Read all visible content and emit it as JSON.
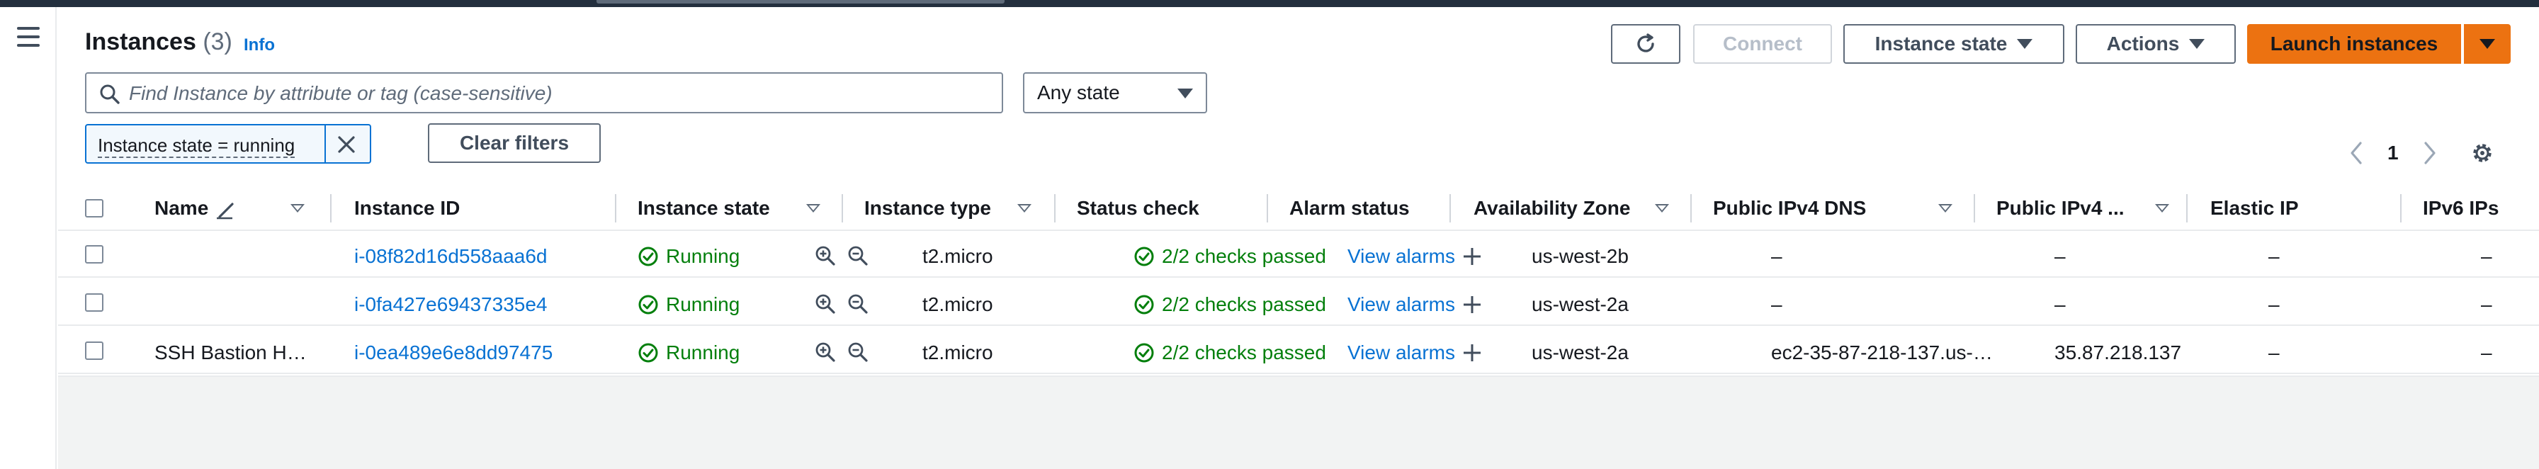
{
  "header": {
    "title": "Instances",
    "count": "(3)",
    "info_link": "Info"
  },
  "toolbar": {
    "refresh_icon": "refresh-icon",
    "connect_label": "Connect",
    "instance_state_label": "Instance state",
    "actions_label": "Actions",
    "launch_label": "Launch instances"
  },
  "search": {
    "placeholder": "Find Instance by attribute or tag (case-sensitive)",
    "value": ""
  },
  "state_filter": {
    "selected": "Any state"
  },
  "filter_token": {
    "label": "Instance state = running"
  },
  "clear_filters_label": "Clear filters",
  "pagination": {
    "current_page": "1"
  },
  "table": {
    "columns": [
      "Name",
      "Instance ID",
      "Instance state",
      "Instance type",
      "Status check",
      "Alarm status",
      "Availability Zone",
      "Public IPv4 DNS",
      "Public IPv4 ...",
      "Elastic IP",
      "IPv6 IPs"
    ],
    "rows": [
      {
        "name": "",
        "instance_id": "i-08f82d16d558aaa6d",
        "state": "Running",
        "type": "t2.micro",
        "status_check": "2/2 checks passed",
        "alarm": "View alarms",
        "az": "us-west-2b",
        "dns": "–",
        "ipv4": "–",
        "elastic_ip": "–",
        "ipv6": "–"
      },
      {
        "name": "",
        "instance_id": "i-0fa427e69437335e4",
        "state": "Running",
        "type": "t2.micro",
        "status_check": "2/2 checks passed",
        "alarm": "View alarms",
        "az": "us-west-2a",
        "dns": "–",
        "ipv4": "–",
        "elastic_ip": "–",
        "ipv6": "–"
      },
      {
        "name": "SSH Bastion H…",
        "instance_id": "i-0ea489e6e8dd97475",
        "state": "Running",
        "type": "t2.micro",
        "status_check": "2/2 checks passed",
        "alarm": "View alarms",
        "az": "us-west-2a",
        "dns": "ec2-35-87-218-137.us-…",
        "ipv4": "35.87.218.137",
        "elastic_ip": "–",
        "ipv6": "–"
      }
    ]
  },
  "colors": {
    "link": "#0972d3",
    "success": "#037f0c",
    "primary_button": "#ec7211",
    "top_bar": "#232f3e"
  }
}
